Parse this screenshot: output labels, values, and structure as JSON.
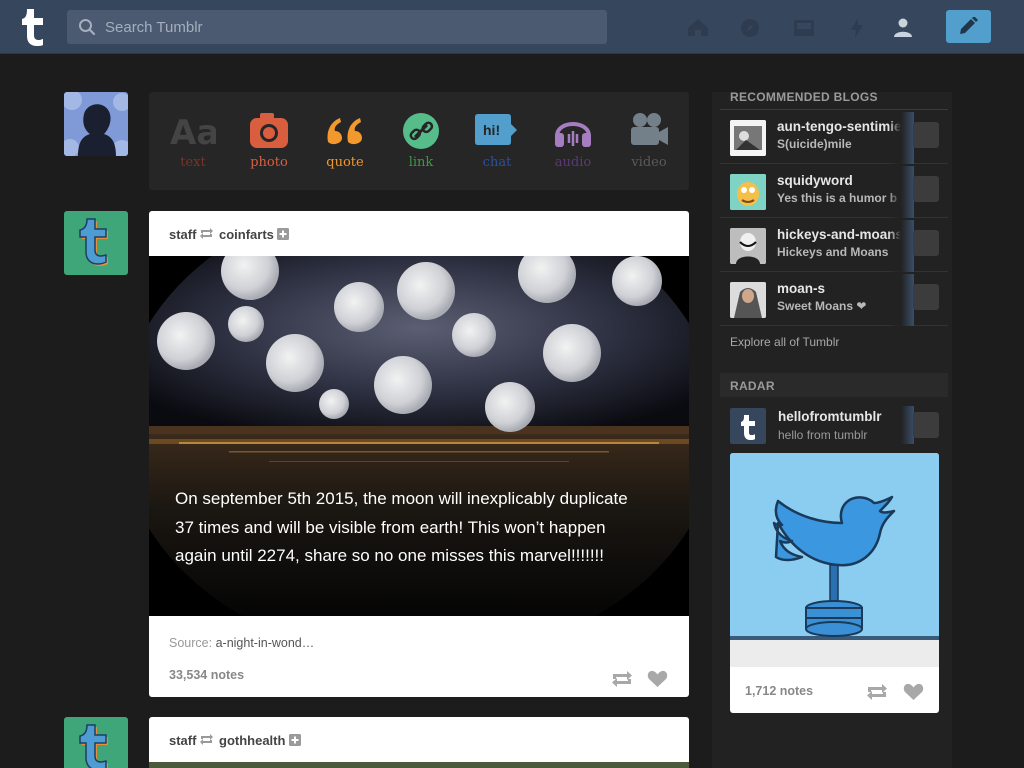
{
  "header": {
    "search_placeholder": "Search Tumblr"
  },
  "post_types": [
    {
      "label": "text",
      "color": "#d95e40"
    },
    {
      "label": "photo",
      "color": "#d95e40"
    },
    {
      "label": "quote",
      "color": "#f2992e"
    },
    {
      "label": "link",
      "color": "#56bc8a"
    },
    {
      "label": "chat",
      "color": "#529ecc"
    },
    {
      "label": "audio",
      "color": "#a77dc2"
    },
    {
      "label": "video",
      "color": "#748089"
    }
  ],
  "posts": [
    {
      "blog": "staff",
      "source_blog": "coinfarts",
      "caption": "On september 5th 2015, the moon will inexplicably duplicate 37 times and will be visible from earth! This won’t happen again until 2274, share so no one misses this marvel!!!!!!!",
      "source_label": "Source:",
      "source_link": "a-night-in-wond…",
      "notes": "33,534 notes"
    },
    {
      "blog": "staff",
      "source_blog": "gothhealth"
    }
  ],
  "sidebar": {
    "recommended_title": "RECOMMENDED BLOGS",
    "recommended": [
      {
        "name": "aun-tengo-sentimie",
        "title": "S(uicide)mile"
      },
      {
        "name": "squidyword",
        "title": "Yes this is a humor b"
      },
      {
        "name": "hickeys-and-moans",
        "title": "Hickeys and Moans"
      },
      {
        "name": "moan-s",
        "title": "Sweet Moans ❤"
      }
    ],
    "explore": "Explore all of Tumblr",
    "radar_title": "RADAR",
    "radar": {
      "name": "hellofromtumblr",
      "title": "hello from tumblr",
      "notes": "1,712 notes"
    }
  }
}
